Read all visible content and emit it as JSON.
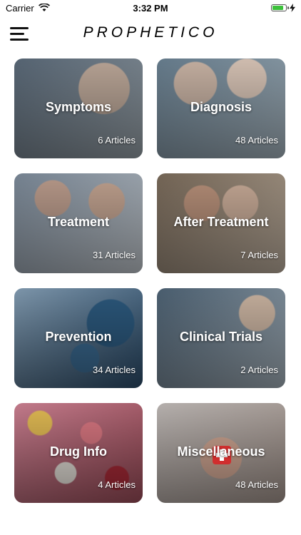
{
  "status": {
    "carrier": "Carrier",
    "time": "3:32 PM",
    "battery_level": 0.9
  },
  "header": {
    "brand": "PROPHETICO"
  },
  "categories": [
    {
      "title": "Symptoms",
      "count": "6 Articles",
      "bg": "#6b7b8c"
    },
    {
      "title": "Diagnosis",
      "count": "48 Articles",
      "bg": "#7a8e9c"
    },
    {
      "title": "Treatment",
      "count": "31 Articles",
      "bg": "#8d97a3"
    },
    {
      "title": "After Treatment",
      "count": "7 Articles",
      "bg": "#9a8a78"
    },
    {
      "title": "Prevention",
      "count": "34 Articles",
      "bg": "#4d6f8e"
    },
    {
      "title": "Clinical Trials",
      "count": "2 Articles",
      "bg": "#6d7f8e"
    },
    {
      "title": "Drug Info",
      "count": "4 Articles",
      "bg": "#b06f78"
    },
    {
      "title": "Miscellaneous",
      "count": "48 Articles",
      "bg": "#c8b7ae"
    }
  ]
}
